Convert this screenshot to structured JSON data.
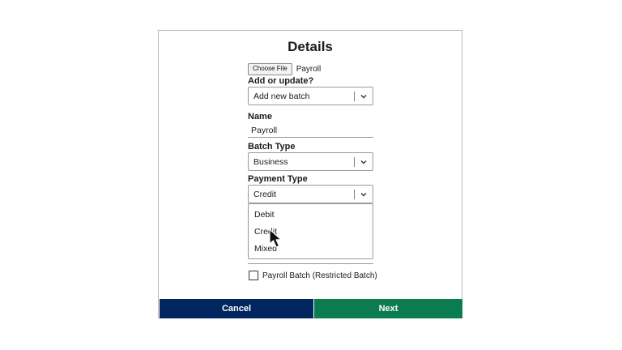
{
  "dialog": {
    "title": "Details",
    "file": {
      "button_label": "Choose File",
      "file_name": "Payroll"
    },
    "add_or_update": {
      "label": "Add or update?",
      "value": "Add new batch"
    },
    "name": {
      "label": "Name",
      "value": "Payroll"
    },
    "batch_type": {
      "label": "Batch Type",
      "value": "Business"
    },
    "payment_type": {
      "label": "Payment Type",
      "value": "Credit",
      "options": [
        "Debit",
        "Credit",
        "Mixed"
      ],
      "open": true
    },
    "payroll_batch_checkbox": {
      "label": "Payroll Batch (Restricted Batch)",
      "checked": false
    },
    "buttons": {
      "cancel": "Cancel",
      "next": "Next"
    }
  },
  "colors": {
    "cancel_bg": "#00255F",
    "next_bg": "#0A7C4F",
    "border": "#9a9a9a"
  },
  "icons": {
    "select_arrow": "chevron-down-icon",
    "pointer": "mouse-cursor-icon"
  }
}
